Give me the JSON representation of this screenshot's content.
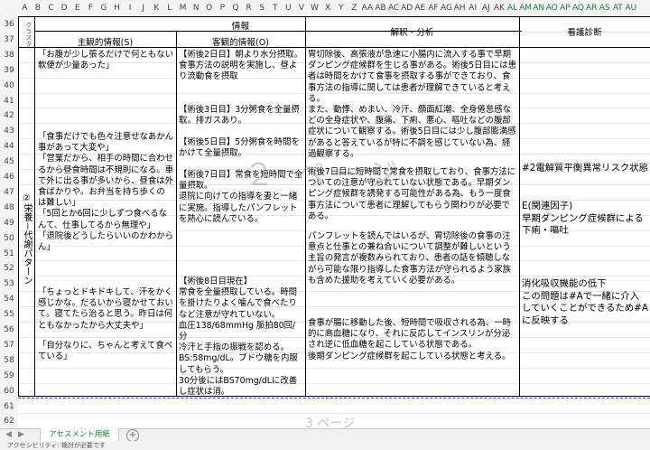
{
  "column_headers": [
    "A",
    "B",
    "C",
    "D",
    "E",
    "F",
    "G",
    "H",
    "I",
    "J",
    "K",
    "L",
    "M",
    "N",
    "O",
    "P",
    "Q",
    "R",
    "S",
    "T",
    "U",
    "V",
    "W",
    "X",
    "Y",
    "Z",
    "AA",
    "AB",
    "AC",
    "AD",
    "AE",
    "AF",
    "AG",
    "AH",
    "AI",
    "AJ",
    "AK",
    "AL",
    "AM",
    "AN",
    "AO",
    "AP",
    "AQ",
    "AR",
    "AS",
    "AT",
    "AU"
  ],
  "row_numbers": [
    "36",
    "37",
    "38",
    "39",
    "40",
    "41",
    "42",
    "43",
    "44",
    "45",
    "46",
    "47",
    "48",
    "49",
    "50",
    "51",
    "52",
    "53",
    "54",
    "55",
    "56",
    "57",
    "58",
    "59",
    "60",
    "61",
    "62"
  ],
  "header": {
    "cluster": "クラスタ",
    "info": "情報",
    "subjective": "主観的情報(S)",
    "objective": "客観的情報(O)",
    "analysis": "解釈・分析",
    "diagnosis": "看護診断"
  },
  "cluster_label": "②栄養－代謝パターン",
  "subjective": {
    "block1": "「お腹が少し張るだけで何ともない軟便が少量あった」",
    "block2": "「食事だけでも色々注意せなあかん事があって大変や」\n「営業だから、相手の時間に合わせるから昼食時間は不規則になる。車で外に出る事が多いから、昼食は外食ばかりや。お弁当を持ち歩くのは難しい」\n「5回とか6回に少しずつ食べるなんて、仕事してるから無理や」\n「退院後どうしたらいいのかわからん」",
    "block3": "「ちょっとドキドキして、汗をかく感じかな。だるいから寝かせておいて。寝てたら治ると思う。昨日は何ともなかったから大丈夫や」",
    "block4": "「自分なりに、ちゃんと考えて食べている」"
  },
  "objective": {
    "block1": "【術後2日目】朝より水分摂取。食事方法の説明を実施し、昼より流動食を摂取",
    "block2": "【術後3日目】3分粥食を全量摂取。排ガスあり。",
    "block3": "【術後5日目】5分粥食を時間をかけて全量摂取。",
    "block4": "【術後7日目】常食を短時間で全量摂取。\n退院に向けての指導を妻と一緒に実施。指導したパンフレットを熱心に読んでいる。",
    "block5": "【術後8日目現在】\n常食を全量摂取している。時間を掛けたりよく噛んで食べたりなど注意が守れていない。\n血圧138/68mmHg 脈拍80回/分\n冷汗と手指の振戦を認める。\nBS:58mg/dL。ブドウ糖を内服してもらう。\n30分後にはBS70mg/dLに改善し症状は消。"
  },
  "analysis": {
    "block1": "胃切除後、高張液が急速に小腸内に流入する事で早期ダンピング症候群を生じる事がある。術後5日目には患者は時間をかけて食事を摂取する事ができており、食事方法の指導に関しては患者が理解できていると考える。\nまた、動悸、めまい、冷汗、顔面紅潮、全身倦怠感などの全身症状や、腹痛、下痢、悪心、嘔吐などの腹部症状について観察する。術後5日目には少し腹部膨満感があると答えているが特に不調を感じていない為、経過観察する。",
    "block2": "術後7日目に短時間で常食を摂取しており、食事方法についての注意が守られていない状態である。早期ダンピング症候群を誘発する可能性がある為、もう一度食事方法について患者に理解してもらう関わりが必要である。",
    "block3": "パンフレットを読んではいるが、胃切除後の食事の注意点と仕事との兼ね合いについて調整が難しいという主旨の発言が複数みられており、患者の話を傾聴しながら可能な限り指導した食事方法が守られるよう家族も含めた援助を考えていく必要がある。",
    "block4": "食事が腸に移動した後、短時間で吸収される為、一時的に高血糖になり、それに反応してインスリンが分泌され逆に低血糖を起こしている状態である。\n後期ダンピング症候群を起こしている状態と考える。"
  },
  "diagnosis": {
    "block1": "#2電解質平衡異常リスク状態",
    "block2": "E(関連因子)\n早期ダンピング症候群による下痢・嘔吐",
    "block3": "消化吸収機能の低下\nこの問題は#Aで一緒に介入していくことができるため#Aに反映する"
  },
  "watermark": {
    "page2": "２ ページ",
    "page3": "3 ページ"
  },
  "tabs": {
    "sheet_name": "アセスメント用紙",
    "add": "+"
  },
  "status": {
    "text": "アクセシビリティ: 検討が必要です"
  }
}
